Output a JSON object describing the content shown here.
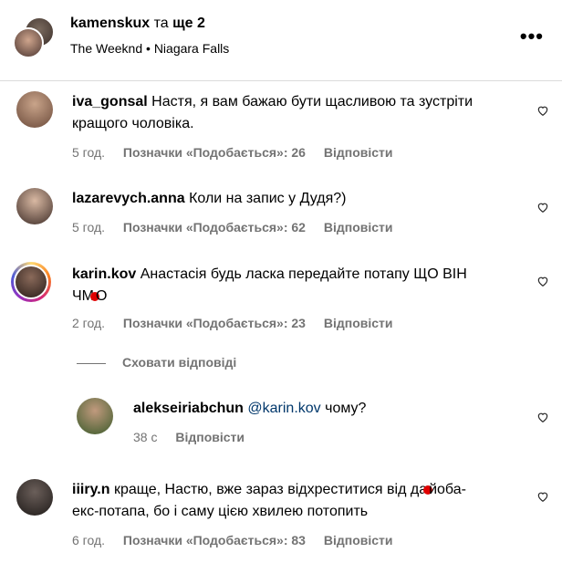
{
  "header": {
    "username": "kamenskux",
    "and_more": "та",
    "more_count": "ще 2",
    "music": "The Weeknd",
    "separator": "•",
    "location": "Niagara Falls",
    "more_icon": "more-horizontal-icon"
  },
  "comments": [
    {
      "user": "iva_gonsal",
      "text": "Настя, я вам бажаю бути щасливою та зустріти кращого чоловіка.",
      "time": "5 год.",
      "likes": "Позначки «Подобається»: 26",
      "reply": "Відповісти"
    },
    {
      "user": "lazarevych.anna",
      "text": "Коли на запис у Дудя?)",
      "time": "5 год.",
      "likes": "Позначки «Подобається»: 62",
      "reply": "Відповісти"
    },
    {
      "user": "karin.kov",
      "text_a": "Анастасія будь ласка передайте потапу ЩО ВІН",
      "text_b1": "ЧМ",
      "text_b2": "О",
      "time": "2 год.",
      "likes": "Позначки «Подобається»: 23",
      "reply": "Відповісти"
    },
    {
      "user": "iiiry.n",
      "text_a": "краще, Настю, вже зараз відхреститися від да",
      "text_b": "йоба-",
      "text_c": "екс-потапа, бо і саму цією хвилею потопить",
      "time": "6 год.",
      "likes": "Позначки «Подобається»: 83",
      "reply": "Відповісти"
    }
  ],
  "hide_replies": "Сховати відповіді",
  "reply": {
    "user": "alekseiriabchun",
    "mention": "@karin.kov",
    "text": "чому?",
    "time": "38 с",
    "reply_label": "Відповісти"
  }
}
